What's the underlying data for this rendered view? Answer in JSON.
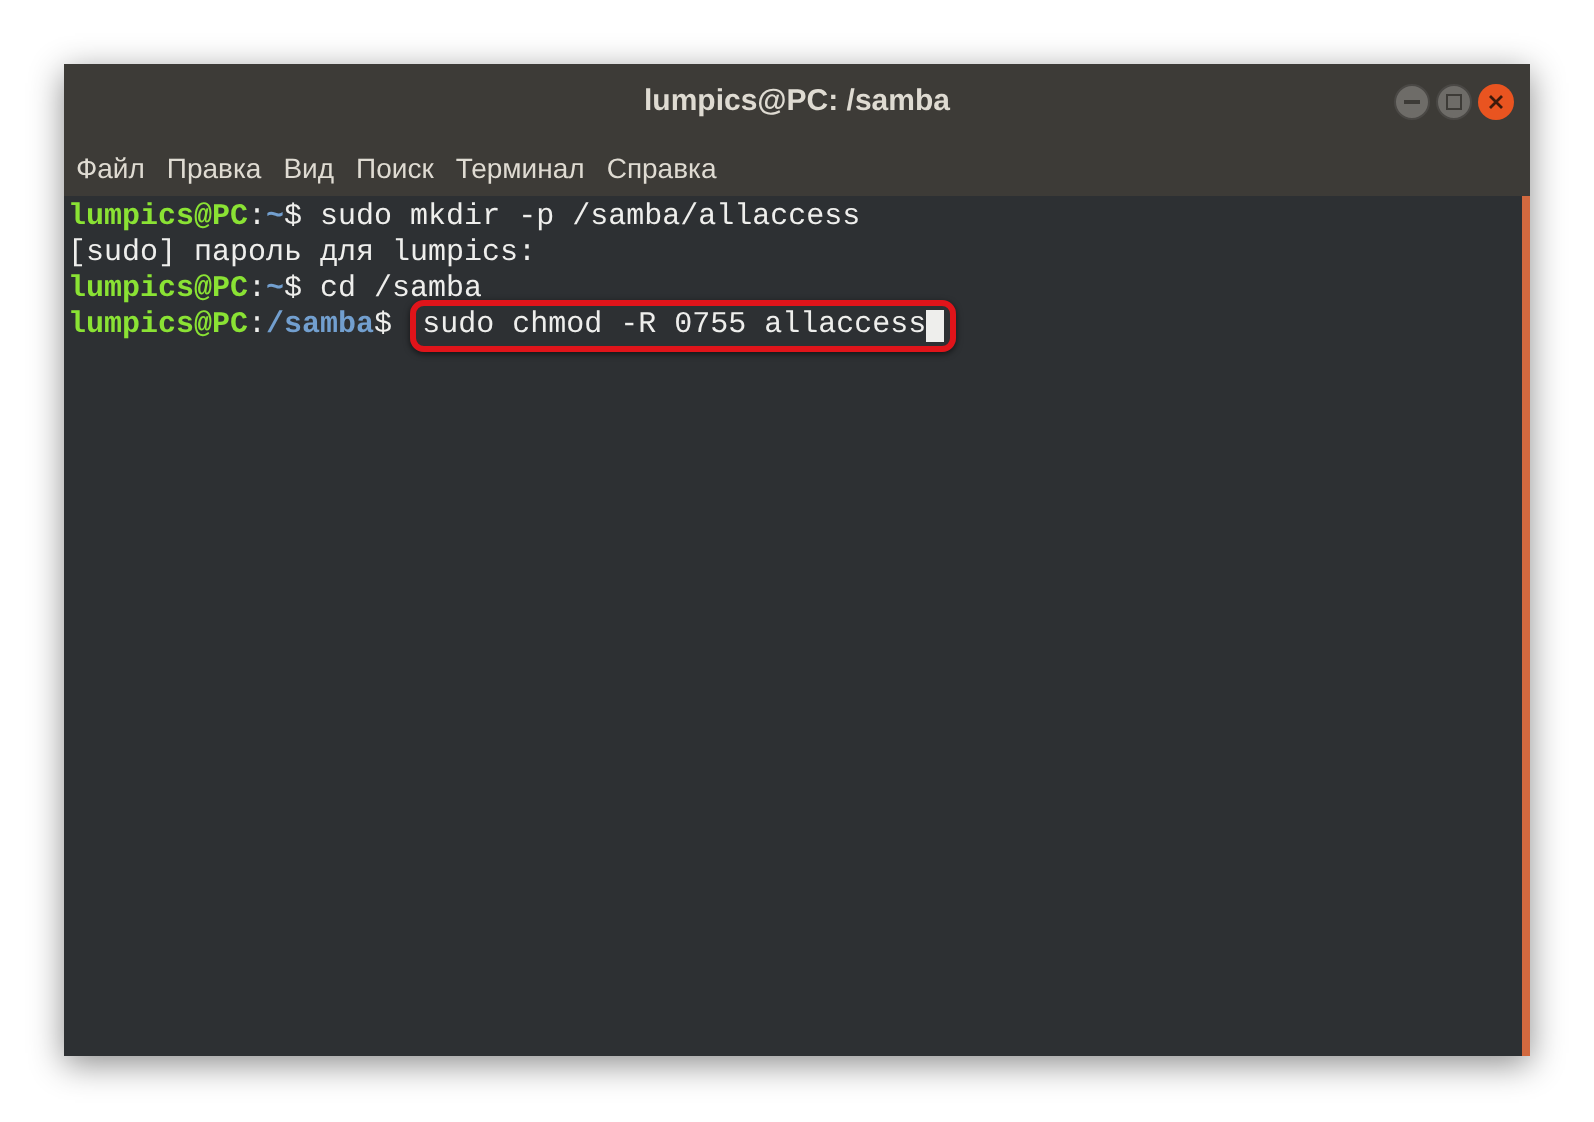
{
  "window": {
    "title": "lumpics@PC: /samba"
  },
  "menu": [
    "Файл",
    "Правка",
    "Вид",
    "Поиск",
    "Терминал",
    "Справка"
  ],
  "terminal": {
    "lines": [
      {
        "segments": [
          {
            "kind": "user",
            "text": "lumpics@PC"
          },
          {
            "kind": "plain",
            "text": ":"
          },
          {
            "kind": "path",
            "text": "~"
          },
          {
            "kind": "plain",
            "text": "$ sudo mkdir -p /samba/allaccess"
          }
        ]
      },
      {
        "segments": [
          {
            "kind": "plain",
            "text": "[sudo] пароль для lumpics:"
          }
        ]
      },
      {
        "segments": [
          {
            "kind": "user",
            "text": "lumpics@PC"
          },
          {
            "kind": "plain",
            "text": ":"
          },
          {
            "kind": "path",
            "text": "~"
          },
          {
            "kind": "plain",
            "text": "$ cd /samba"
          }
        ]
      },
      {
        "segments": [
          {
            "kind": "user",
            "text": "lumpics@PC"
          },
          {
            "kind": "plain",
            "text": ":"
          },
          {
            "kind": "path",
            "text": "/samba"
          },
          {
            "kind": "plain",
            "text": "$"
          },
          {
            "kind": "highlighted",
            "text": "sudo chmod -R 0755 allaccess"
          }
        ],
        "cursor": true
      }
    ]
  }
}
